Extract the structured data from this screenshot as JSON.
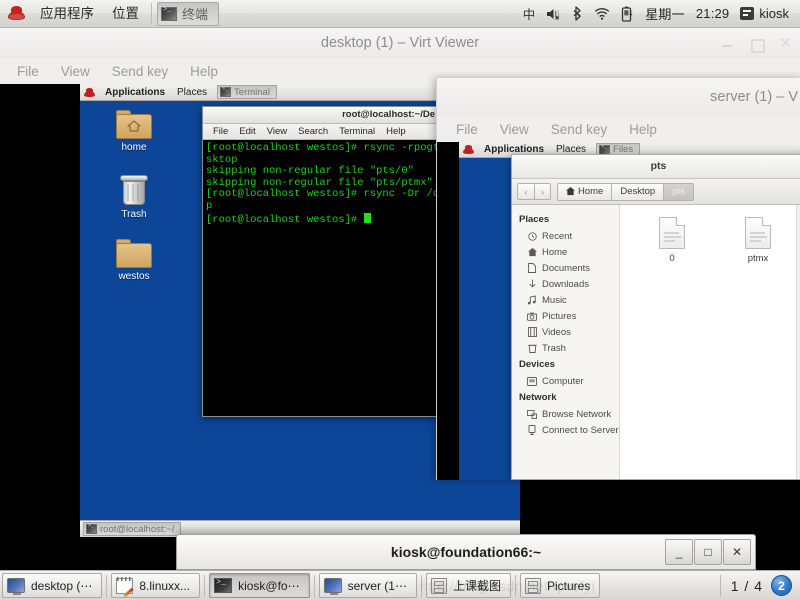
{
  "top_panel": {
    "applications_label": "应用程序",
    "places_label": "位置",
    "window_task": "终端",
    "indicators": {
      "ime": "中",
      "volume": "volume-muted-icon",
      "bluetooth": "bluetooth-icon",
      "wifi": "wifi-icon",
      "battery": "battery-charging-icon"
    },
    "day": "星期一",
    "time": "21:29",
    "user": "kiosk"
  },
  "virt_viewer_desktop": {
    "title": "desktop (1) – Virt Viewer",
    "menus": [
      "File",
      "View",
      "Send key",
      "Help"
    ],
    "window_buttons": {
      "minimize": "_",
      "maximize": "□",
      "close": "✕"
    },
    "vm_panel": {
      "applications_label": "Applications",
      "places_label": "Places",
      "task": "Terminal"
    },
    "desktop_icons": [
      {
        "label": "home",
        "icon": "home-folder-icon"
      },
      {
        "label": "Trash",
        "icon": "trash-icon"
      },
      {
        "label": "westos",
        "icon": "folder-icon"
      }
    ],
    "terminal": {
      "title": "root@localhost:~/De",
      "menus": [
        "File",
        "Edit",
        "View",
        "Search",
        "Terminal",
        "Help"
      ],
      "lines": [
        "[root@localhost westos]# rsync -rpogtl /d",
        "sktop",
        "skipping non-regular file \"pts/0\"",
        "skipping non-regular file \"pts/ptmx\"",
        "[root@localhost westos]# rsync -Dr /dev/p",
        "p",
        "[root@localhost westos]# "
      ]
    },
    "vm_taskbar_item": "root@localhost:~/"
  },
  "virt_viewer_server": {
    "title": "server (1) – V",
    "menus": [
      "File",
      "View",
      "Send key",
      "Help"
    ],
    "vm_panel": {
      "applications_label": "Applications",
      "places_label": "Places",
      "task": "Files"
    },
    "files_window": {
      "title": "pts",
      "nav": {
        "back": "‹",
        "forward": "›"
      },
      "breadcrumbs": [
        {
          "label": "Home",
          "icon": "home-icon",
          "active": false
        },
        {
          "label": "Desktop",
          "icon": "",
          "active": false
        },
        {
          "label": "pts",
          "icon": "",
          "active": true
        }
      ],
      "sidebar": [
        {
          "type": "group",
          "label": "Places"
        },
        {
          "type": "item",
          "label": "Recent",
          "icon": "clock-icon"
        },
        {
          "type": "item",
          "label": "Home",
          "icon": "home-icon"
        },
        {
          "type": "item",
          "label": "Documents",
          "icon": "document-icon"
        },
        {
          "type": "item",
          "label": "Downloads",
          "icon": "download-arrow-icon"
        },
        {
          "type": "item",
          "label": "Music",
          "icon": "music-note-icon"
        },
        {
          "type": "item",
          "label": "Pictures",
          "icon": "camera-icon"
        },
        {
          "type": "item",
          "label": "Videos",
          "icon": "film-icon"
        },
        {
          "type": "item",
          "label": "Trash",
          "icon": "trash-icon"
        },
        {
          "type": "group",
          "label": "Devices"
        },
        {
          "type": "item",
          "label": "Computer",
          "icon": "computer-icon"
        },
        {
          "type": "group",
          "label": "Network"
        },
        {
          "type": "item",
          "label": "Browse Network",
          "icon": "network-icon"
        },
        {
          "type": "item",
          "label": "Connect to Server",
          "icon": "server-icon"
        }
      ],
      "files": [
        {
          "name": "0",
          "icon": "text-file-icon"
        },
        {
          "name": "ptmx",
          "icon": "text-file-icon"
        }
      ]
    }
  },
  "kiosk_window": {
    "title": "kiosk@foundation66:~",
    "buttons": {
      "minimize": "_",
      "maximize": "□",
      "close": "✕"
    }
  },
  "taskbar": {
    "items": [
      {
        "label": "desktop (⋯",
        "icon": "monitor-icon",
        "pressed": false
      },
      {
        "label": "8.linuxx...",
        "icon": "notepad-icon",
        "pressed": false
      },
      {
        "label": "kiosk@fo⋯",
        "icon": "terminal-icon",
        "pressed": true
      },
      {
        "label": "server (1⋯",
        "icon": "monitor-icon",
        "pressed": false
      },
      {
        "label": "上课截图",
        "icon": "cabinet-icon",
        "pressed": false
      },
      {
        "label": "Pictures",
        "icon": "cabinet-icon",
        "pressed": false
      }
    ],
    "pager": "1 / 4",
    "notification_count": "2",
    "watermark": "http://blog.csdn.net/qwefyi"
  },
  "colors": {
    "desktop_blue": "#0d4699",
    "terminal_green": "#18d318",
    "panel_grey": "#e6e5e2",
    "accent_blue": "#2f79c9"
  }
}
